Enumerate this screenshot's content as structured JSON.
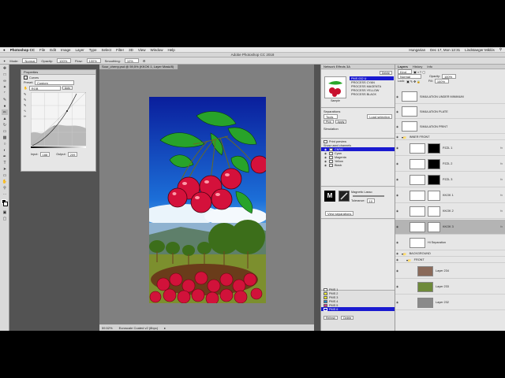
{
  "menubar": {
    "app_name": "Photoshop CC",
    "items": [
      "File",
      "Edit",
      "Image",
      "Layer",
      "Type",
      "Select",
      "Filter",
      "3D",
      "View",
      "Window",
      "Help"
    ],
    "status_right": [
      "Hungarian",
      "Dec 17, Mon 12:31",
      "Lindstaeger Miklós"
    ]
  },
  "window_title": "Adobe Photoshop CC 2018",
  "options_bar": {
    "mode_label": "Mode:",
    "mode_value": "Normal",
    "opacity_label": "Opacity:",
    "opacity_value": "100%",
    "flow_label": "Flow:",
    "flow_value": "100%",
    "smoothing_label": "Smoothing:",
    "smoothing_value": "10%"
  },
  "properties_panel": {
    "title": "Properties",
    "adjustment_name": "Curves",
    "preset_label": "Preset:",
    "preset_value": "Custom",
    "channel_value": "RGB",
    "auto_label": "Auto",
    "input_label": "Input:",
    "input_value": "188",
    "output_label": "Output:",
    "output_value": "209"
  },
  "document": {
    "tab_label": "Sour_cherry.psd @ 59,5% (KKOK 1, Layer Mask/8)",
    "zoom": "59.52%",
    "profile": "Euroscale Coated v2 (8bpc)"
  },
  "separations_panel": {
    "title": "Network Effects 3A",
    "button_label": "Delete",
    "thumb_caption": "Sample",
    "items": [
      "PMS 032 U",
      "PROCESS CYAN",
      "PROCESS MAGENTA",
      "PROCESS YELLOW",
      "PROCESS BLACK"
    ],
    "section_label": "Separations",
    "tools_label": "Tools",
    "loaded_label": "Load selection",
    "simulation_label": "Simulation",
    "print_preview": "Print preview",
    "show_used": "Show used channels",
    "channels": [
      "CMYK",
      "Cyan",
      "Magenta",
      "Yellow",
      "Black"
    ],
    "brush_caption": "Magnetic Lasso",
    "tolerance_label": "Tolerance:",
    "tolerance_value": "10",
    "view_label": "View separations",
    "spots": [
      {
        "name": "PMS 1",
        "color": "#ffffff"
      },
      {
        "name": "PMS 2",
        "color": "#f4ef3a"
      },
      {
        "name": "PMS 3",
        "color": "#e9e61e"
      },
      {
        "name": "PMS 4",
        "color": "#1a8ad0"
      },
      {
        "name": "PMS 5",
        "color": "#d8348c"
      },
      {
        "name": "PMS 6",
        "color": "#1010c8"
      }
    ],
    "footer_left": "Refresh",
    "footer_right": "Delete"
  },
  "layers_panel": {
    "tabs": [
      "Layers",
      "History",
      "Info"
    ],
    "kind_label": "Kind",
    "blend_value": "Normal",
    "opacity_label": "Opacity:",
    "opacity_value": "100%",
    "lock_label": "Lock:",
    "fill_label": "Fill:",
    "fill_value": "100%",
    "layers": [
      {
        "name": "SIMULATION UNDER MINIMUM",
        "type": "plain",
        "selected": false
      },
      {
        "name": "SIMULATION PLATE",
        "type": "plain",
        "selected": false
      },
      {
        "name": "SIMULATION PRINT",
        "type": "plain",
        "selected": false
      },
      {
        "name": "INNER FRONT",
        "type": "group",
        "selected": false
      },
      {
        "name": "PZZL 1",
        "type": "mask",
        "selected": false
      },
      {
        "name": "PZZL 2",
        "type": "mask",
        "selected": false
      },
      {
        "name": "PZZL 3",
        "type": "mask",
        "selected": false
      },
      {
        "name": "KKOK 1",
        "type": "mask",
        "selected": false
      },
      {
        "name": "KKOK 2",
        "type": "mask",
        "selected": false
      },
      {
        "name": "KKOK 3",
        "type": "mask",
        "selected": true
      },
      {
        "name": "Hi Separation",
        "type": "plain",
        "selected": false
      },
      {
        "name": "BACKGROUND",
        "type": "group",
        "selected": false
      },
      {
        "name": "FRONT",
        "type": "group",
        "selected": false
      },
      {
        "name": "Layer 234",
        "type": "photo",
        "selected": false
      },
      {
        "name": "Layer 233",
        "type": "photo",
        "selected": false
      },
      {
        "name": "Layer 232",
        "type": "photo",
        "selected": false
      }
    ]
  },
  "colors": {
    "selected_row": "#1a1ad0",
    "ui_dark": "#535353"
  }
}
